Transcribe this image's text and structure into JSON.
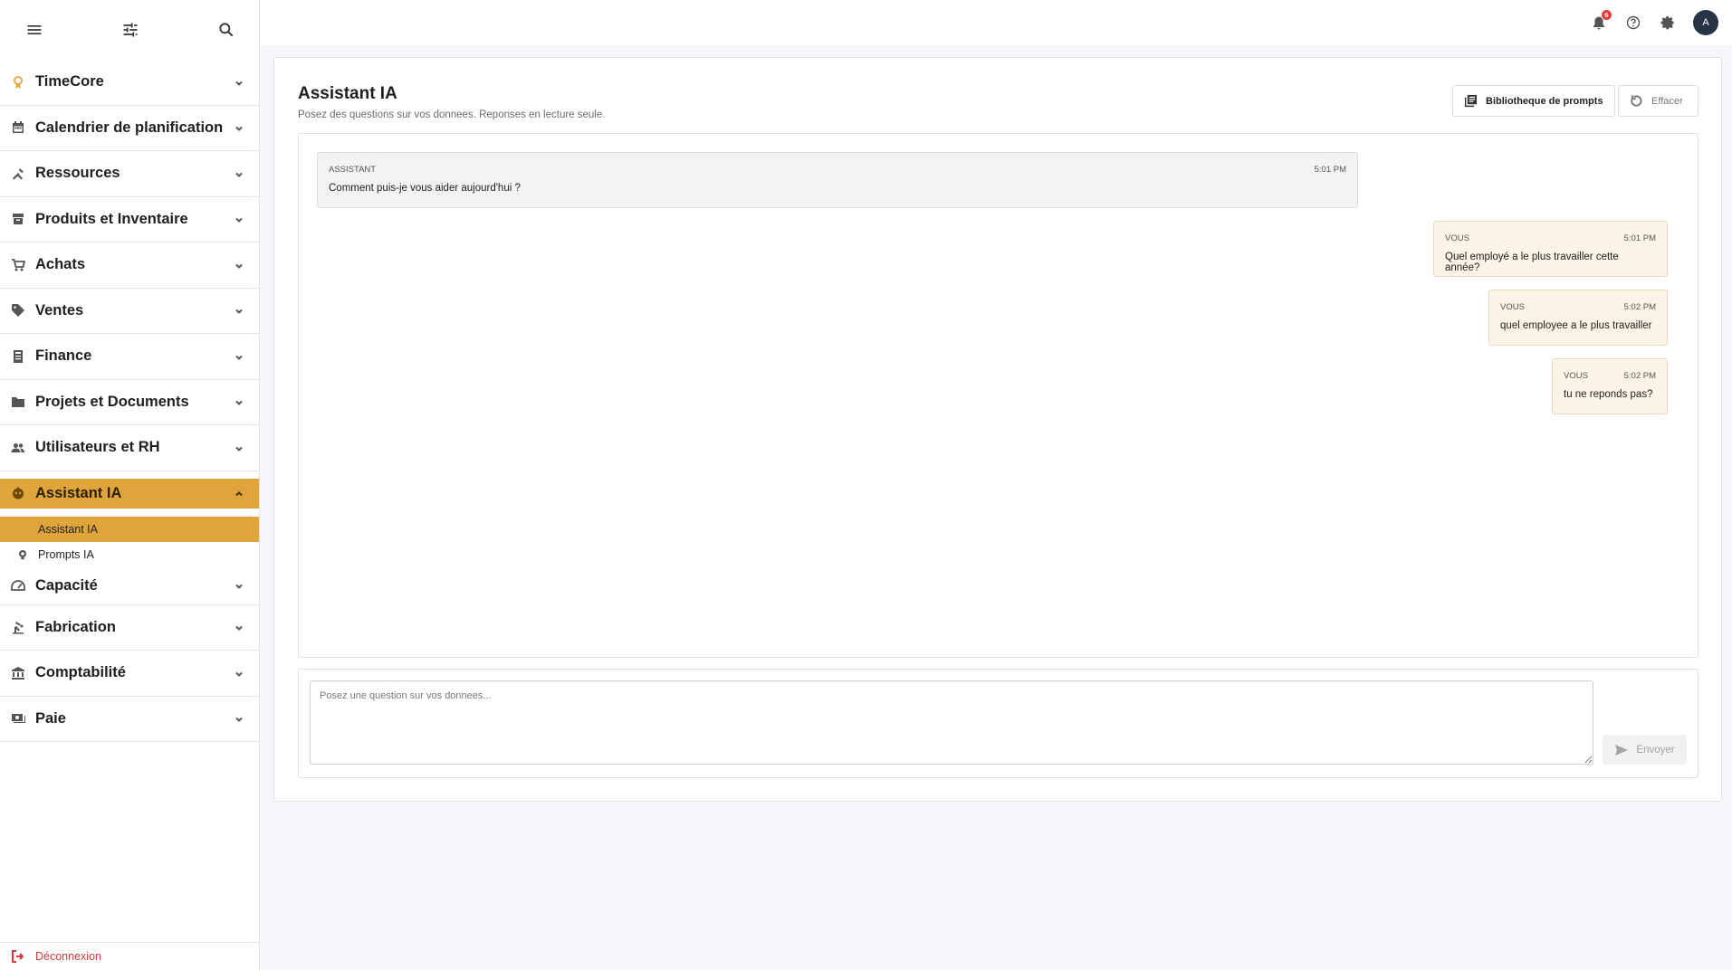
{
  "sidebar": {
    "groups": [
      {
        "label": "TimeCore",
        "icon": "timecore-icon"
      },
      {
        "label": "Calendrier de planification",
        "icon": "calendar-icon"
      },
      {
        "label": "Ressources",
        "icon": "tools-icon"
      },
      {
        "label": "Produits et Inventaire",
        "icon": "inventory-icon"
      },
      {
        "label": "Achats",
        "icon": "cart-icon"
      },
      {
        "label": "Ventes",
        "icon": "tag-icon"
      },
      {
        "label": "Finance",
        "icon": "finance-icon"
      },
      {
        "label": "Projets et Documents",
        "icon": "folder-icon"
      },
      {
        "label": "Utilisateurs et RH",
        "icon": "users-icon"
      },
      {
        "label": "Assistant IA",
        "icon": "robot-icon"
      },
      {
        "label": "Capacité",
        "icon": "gauge-icon"
      },
      {
        "label": "Fabrication",
        "icon": "factory-icon"
      },
      {
        "label": "Comptabilité",
        "icon": "bank-icon"
      },
      {
        "label": "Paie",
        "icon": "payroll-icon"
      }
    ],
    "sub_items": [
      {
        "label": "Assistant IA"
      },
      {
        "label": "Prompts IA"
      }
    ],
    "logout_label": "Déconnexion"
  },
  "topbar": {
    "notification_count": "6",
    "avatar_initial": "A"
  },
  "page": {
    "title": "Assistant IA",
    "subtitle": "Posez des questions sur vos donnees. Reponses en lecture seule.",
    "library_button": "Bibliotheque de prompts",
    "clear_button": "Effacer"
  },
  "messages": [
    {
      "role": "ASSISTANT",
      "time": "5:01 PM",
      "text": "Comment puis-je vous aider aujourd'hui ?"
    },
    {
      "role": "VOUS",
      "time": "5:01 PM",
      "text": "Quel employé a le plus travailler cette année?"
    },
    {
      "role": "VOUS",
      "time": "5:02 PM",
      "text": "quel employee a le plus travailler"
    },
    {
      "role": "VOUS",
      "time": "5:02 PM",
      "text": "tu ne reponds pas?"
    }
  ],
  "composer": {
    "placeholder": "Posez une question sur vos donnees...",
    "send_label": "Envoyer"
  },
  "colors": {
    "accent": "#dfa53b",
    "user_bubble": "#fbf3e6",
    "assistant_bubble": "#f3f3f3",
    "logout": "#d23a3a",
    "badge": "#e33b3b"
  }
}
